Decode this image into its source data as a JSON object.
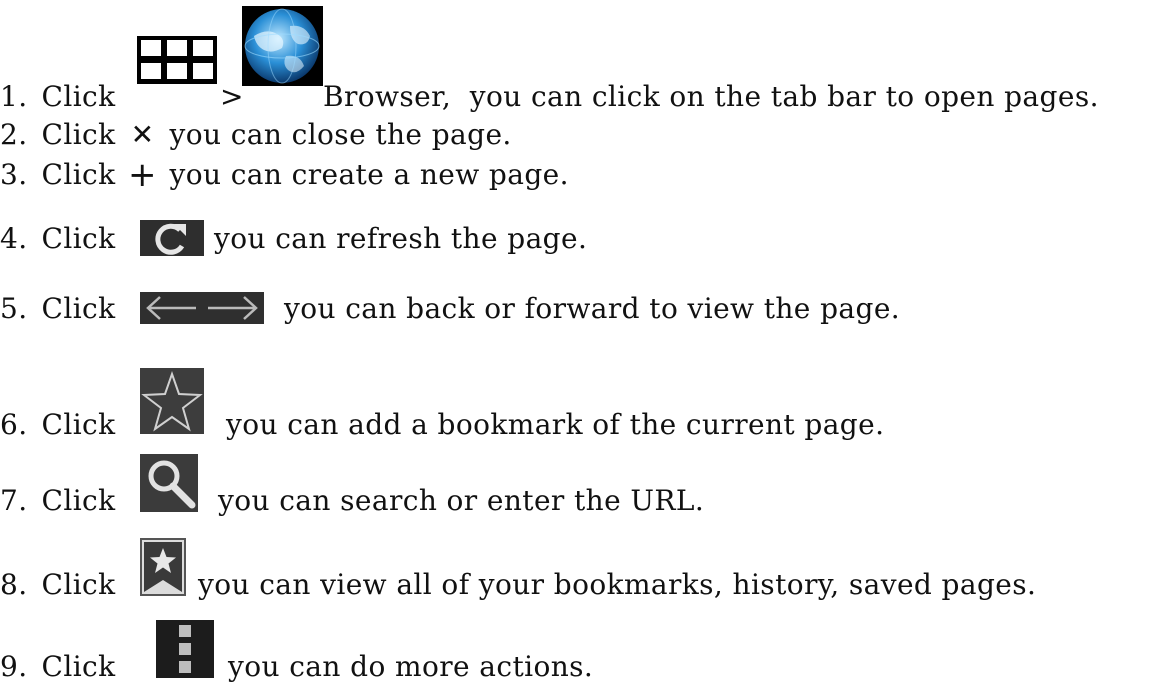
{
  "instructions": [
    {
      "num": "1.",
      "before": "Click",
      "sep": ">",
      "after": "Browser,  you can click on the tab bar to open pages.",
      "icons": [
        "apps-grid-icon",
        "browser-globe-icon"
      ]
    },
    {
      "num": "2.",
      "before": "Click",
      "glyph": "✕",
      "after": "you can close the page.",
      "icons": [
        "close-icon"
      ]
    },
    {
      "num": "3.",
      "before": "Click",
      "glyph": "+",
      "after": "you can create a new page.",
      "icons": [
        "plus-icon"
      ]
    },
    {
      "num": "4.",
      "before": "Click",
      "after": "you can refresh the page.",
      "icons": [
        "refresh-icon"
      ]
    },
    {
      "num": "5.",
      "before": "Click",
      "after": "you can back or forward to view the page.",
      "icons": [
        "back-arrow-icon",
        "forward-arrow-icon"
      ]
    },
    {
      "num": "6.",
      "before": "Click",
      "after": "you can add a bookmark of the current page.",
      "icons": [
        "star-outline-icon"
      ]
    },
    {
      "num": "7.",
      "before": "Click",
      "after": "you can search or enter the URL.",
      "icons": [
        "search-icon"
      ]
    },
    {
      "num": "8.",
      "before": "Click",
      "after": "you can view all of your bookmarks, history, saved pages.",
      "icons": [
        "bookmarks-icon"
      ]
    },
    {
      "num": "9.",
      "before": "Click",
      "after": "you can do more actions.",
      "icons": [
        "overflow-menu-icon"
      ]
    }
  ],
  "colors": {
    "text": "#111111",
    "icon_dark": "#3a3a3a",
    "grid_bg": "#000000"
  }
}
